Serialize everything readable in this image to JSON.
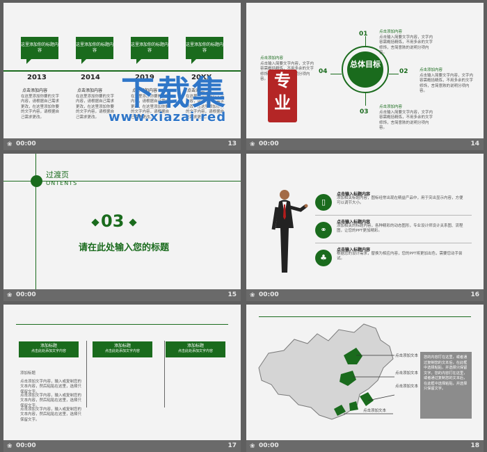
{
  "watermark": {
    "title": "下载集",
    "stamp": "专业",
    "url": "www.xiazai.red"
  },
  "footer": {
    "play_icon": "animation-icon",
    "duration": "00:00"
  },
  "slide13": {
    "number": "13",
    "boxes": [
      "这里添加你的标题内容",
      "这里添加你的标题内容",
      "这里添加你的标题内容",
      "这里添加你的标题内容"
    ],
    "years": [
      "2013",
      "2014",
      "2019",
      "20XX"
    ],
    "headings": [
      "点击添加内容",
      "点击添加内容",
      "点击添加内容",
      "点击添加内容"
    ],
    "texts": [
      "在这里添加你要的文字内容，请根据自己需求更改，在这里添加你要的文字内容，请根据自己需求更改。",
      "在这里添加你要的文字内容，请根据自己需求更改，在这里添加你要的文字内容，请根据自己需求更改。",
      "在这里添加你要的文字内容，请根据自己需求更改，在这里添加你要的文字内容，请根据自己需求更改。",
      "在这里添加你要的文字内容，请根据自己需求更改，在这里添加你要的文字内容，请根据自己需求更改。"
    ]
  },
  "slide14": {
    "number": "14",
    "center": "总体目标",
    "labels": [
      "01",
      "02",
      "03",
      "04"
    ],
    "headings": [
      "点击添加内容",
      "点击添加内容",
      "点击添加内容",
      "点击添加内容"
    ],
    "texts": [
      "点击输入简要文字内容，文字内容需概括精炼，不用多余的文字修饰，言简意赅的说明分项内容。",
      "点击输入简要文字内容，文字内容需概括精炼，不用多余的文字修饰，言简意赅的说明分项内容。",
      "点击输入简要文字内容，文字内容需概括精炼，不用多余的文字修饰，言简意赅的说明分项内容。",
      "点击输入简要文字内容，文字内容需概括精炼，不用多余的文字修饰，言简意赅的说明分项内容。"
    ]
  },
  "slide15": {
    "number": "15",
    "title_cn": "过渡页",
    "title_en": "ONTENTS",
    "section": "03",
    "heading": "请在此处输入您的标题"
  },
  "slide16": {
    "number": "16",
    "headings": [
      "点击输入标题内容",
      "点击输入标题内容",
      "点击输入标题内容"
    ],
    "texts": [
      "添加相关标题内容，图标经常出现在精益产品中，用于突出显示内容，方便可以调节大小。",
      "添加相关的标题内容，各种精彩的动态图形，专业设计师设计关系图、流程图，让您的PPT更加精彩。",
      "根据您的设计需求，替换为相应内容，您的PPT将更加出色，需要您动手尝试。"
    ]
  },
  "slide17": {
    "number": "17",
    "panels": [
      {
        "title": "添加标题",
        "sub": "点击此处添加文字内容"
      },
      {
        "title": "添加标题",
        "sub": "点击此处添加文字内容"
      },
      {
        "title": "添加标题",
        "sub": "点击此处添加文字内容"
      }
    ],
    "label": "添加标题",
    "texts": [
      "点击添加文字内容，输入或复制您的文本内容，然后粘贴在这里，选择只保留文字。",
      "点击添加文字内容，输入或复制您的文本内容，然后粘贴在这里，选择只保留文字。",
      "点击添加文字内容，输入或复制您的文本内容，然后粘贴在这里，选择只保留文字。"
    ]
  },
  "slide18": {
    "number": "18",
    "labels": [
      "点击添加文本",
      "点击添加文本",
      "点击添加文本",
      "点击添加文本"
    ],
    "note": "您的内容打在这里，或者通过复制您的文本后，在此框中选择粘贴，并选择只保留文字。您的内容打在这里，或者通过复制您的文本后，在此框中选择粘贴，并选择只保留文字。"
  }
}
